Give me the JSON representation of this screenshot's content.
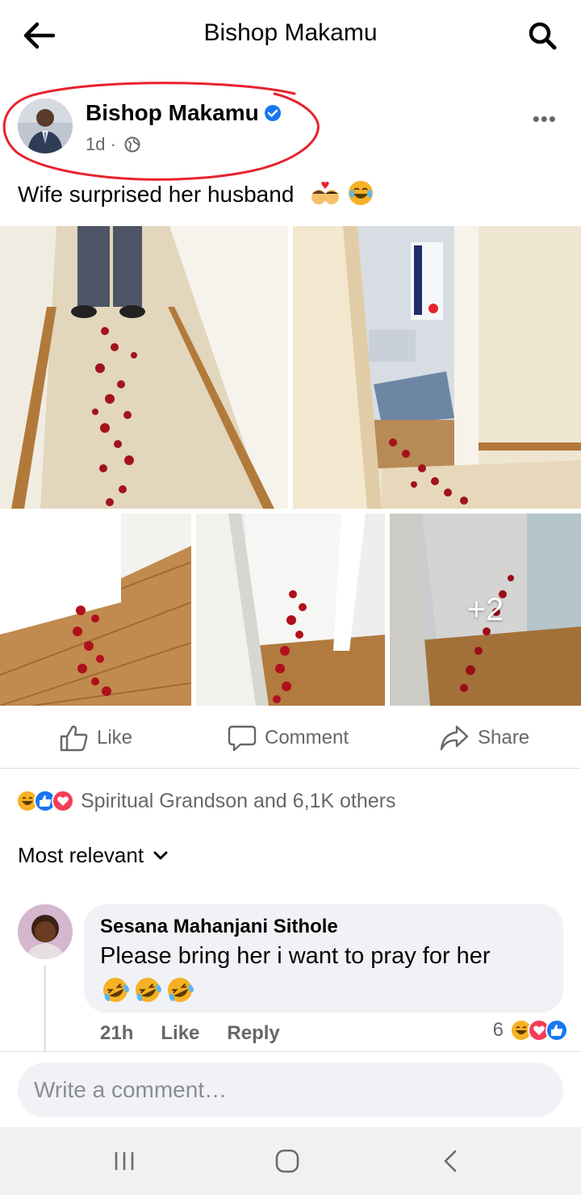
{
  "topbar": {
    "title": "Bishop Makamu",
    "back_icon": "arrow-left-icon",
    "search_icon": "search-icon"
  },
  "post": {
    "author": "Bishop Makamu",
    "time": "1d",
    "separator": "·",
    "privacy_icon": "globe-icon",
    "more": "•••",
    "caption": "Wife surprised her husband",
    "caption_emojis": [
      "couple-with-heart-icon",
      "tears-of-joy-icon"
    ],
    "photos_more": "+2"
  },
  "actions": {
    "like": "Like",
    "comment": "Comment",
    "share": "Share"
  },
  "reactions": {
    "icons": [
      "haha-icon",
      "like-icon",
      "love-icon"
    ],
    "summary": "Spiritual Grandson and 6,1K others"
  },
  "sort": {
    "label": "Most relevant"
  },
  "comment": {
    "name": "Sesana Mahanjani Sithole",
    "text": "Please bring her i want to pray for her",
    "emojis": [
      "rofl-icon",
      "rofl-icon",
      "rofl-icon"
    ],
    "time": "21h",
    "like": "Like",
    "reply": "Reply",
    "reaction_count": "6",
    "reaction_icons": [
      "haha-icon",
      "love-icon",
      "like-icon"
    ]
  },
  "composer": {
    "placeholder": "Write a comment…"
  },
  "colors": {
    "fb_blue": "#1877f2",
    "love_red": "#f33e58",
    "haha_yellow": "#f7b125",
    "secondary_text": "#65676b"
  }
}
